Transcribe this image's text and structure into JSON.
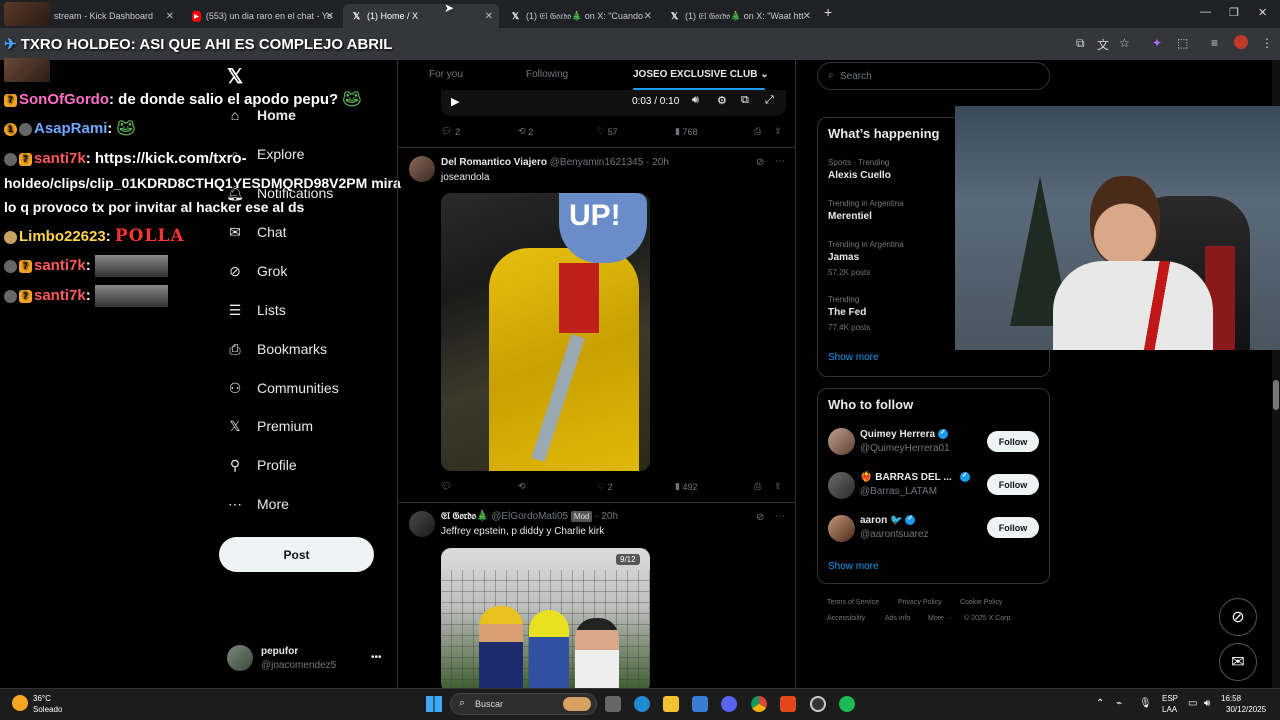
{
  "browser": {
    "tabs": [
      {
        "title": "stream - Kick Dashboard",
        "favicon": "kick-icon"
      },
      {
        "title": "(553) un dia raro en el chat - Yo",
        "favicon": "youtube-icon"
      },
      {
        "title": "(1) Home / X",
        "favicon": "x-icon",
        "active": true
      },
      {
        "title": "(1) 𝔈𝔩 𝔊𝔬𝔯𝔡𝔬🎄 on X: \"Cuando",
        "favicon": "x-icon"
      },
      {
        "title": "(1) 𝔈𝔩 𝔊𝔬𝔯𝔡𝔬🎄 on X: \"Waat htt",
        "favicon": "x-icon"
      }
    ],
    "new_tab": "+",
    "window_controls": [
      "—",
      "❐",
      "✕"
    ]
  },
  "stream_title": "TXRO HOLDEO: ASI QUE AHI ES COMPLEJO ABRIL",
  "chat": [
    {
      "user": "SonOfGordo",
      "text": "de donde salio el apodo pepu?",
      "user_color": "#ff6ec7"
    },
    {
      "user": "AsapRami",
      "text": "",
      "user_color": "#6ea8ff"
    },
    {
      "user": "santi7k",
      "text": "https://kick.com/txro-",
      "user_color": "#ff5a5a"
    },
    {
      "user": "",
      "text": "holdeo/clips/clip_01KDRD8CTHQ1YESDMQRD98V2PM mira",
      "user_color": ""
    },
    {
      "user": "",
      "text": "lo q provoco tx por invitar al hacker ese al ds",
      "user_color": ""
    },
    {
      "user": "Limbo22623",
      "text": "POLLA",
      "user_color": "#ffd34d"
    },
    {
      "user": "santi7k",
      "text": "",
      "user_color": "#ff5a5a"
    },
    {
      "user": "santi7k",
      "text": "",
      "user_color": "#ff5a5a"
    }
  ],
  "sidebar": {
    "items": [
      {
        "label": "Home",
        "icon": "home-icon"
      },
      {
        "label": "Explore",
        "icon": "search-icon"
      },
      {
        "label": "Notifications",
        "icon": "bell-icon"
      },
      {
        "label": "Chat",
        "icon": "mail-icon"
      },
      {
        "label": "Grok",
        "icon": "grok-icon"
      },
      {
        "label": "Lists",
        "icon": "list-icon"
      },
      {
        "label": "Bookmarks",
        "icon": "bookmark-icon"
      },
      {
        "label": "Communities",
        "icon": "people-icon"
      },
      {
        "label": "Premium",
        "icon": "x-icon"
      },
      {
        "label": "Profile",
        "icon": "person-icon"
      },
      {
        "label": "More",
        "icon": "more-icon"
      }
    ],
    "post_label": "Post",
    "account": {
      "name": "pepufor",
      "handle": "@joacomendez5",
      "menu": "•••"
    }
  },
  "feed": {
    "tabs": [
      "For you",
      "Following",
      "JOSEO EXCLUSIVE CLUB"
    ],
    "video": {
      "time": "0:03 / 0:10"
    },
    "post0_actions": {
      "replies": "2",
      "reposts": "2",
      "likes": "57",
      "views": "768"
    },
    "post1": {
      "name": "Del Romantico Viajero",
      "handle": "@Benyamin1621345",
      "time": "· 20h",
      "text": "joseandola",
      "image_text": "UP!",
      "actions": {
        "replies": "",
        "reposts": "",
        "likes": "2",
        "views": "492"
      }
    },
    "post2": {
      "name": "𝔈𝔩 𝔊𝔬𝔯𝔡𝔬🎄",
      "handle": "@ElGordoMati05",
      "badge": "Mod",
      "time": "· 20h",
      "text": "Jeffrey epstein, p diddy y Charlie kirk",
      "image_counter": "9/12"
    }
  },
  "right": {
    "search_placeholder": "Search",
    "whats_happening": "What’s happening",
    "trends": [
      {
        "category": "Sports · Trending",
        "name": "Alexis Cuello",
        "posts": ""
      },
      {
        "category": "Trending in Argentina",
        "name": "Merentiel",
        "posts": ""
      },
      {
        "category": "Trending in Argentina",
        "name": "Jamas",
        "posts": "57,2K posts"
      },
      {
        "category": "Trending",
        "name": "The Fed",
        "posts": "77,4K posts"
      }
    ],
    "show_more": "Show more",
    "who_to_follow": "Who to follow",
    "follow_suggestions": [
      {
        "name": "Quimey Herrera",
        "handle": "@QuimeyHerrera01",
        "button": "Follow"
      },
      {
        "name": "❤️‍🔥 BARRAS DEL ...",
        "handle": "@Barras_LATAM",
        "button": "Follow"
      },
      {
        "name": "aaron 🐦",
        "handle": "@aarontsuarez",
        "button": "Follow"
      }
    ],
    "show_more_2": "Show more",
    "footer": [
      "Terms of Service",
      "Privacy Policy",
      "Cookie Policy",
      "Accessibility",
      "Ads info",
      "More ···",
      "© 2025 X Corp."
    ]
  },
  "taskbar": {
    "weather_temp": "36°C",
    "weather_desc": "Soleado",
    "search_label": "Buscar",
    "lang": "ESP",
    "lang2": "LAA",
    "time": "16:58",
    "date": "30/12/2025"
  }
}
